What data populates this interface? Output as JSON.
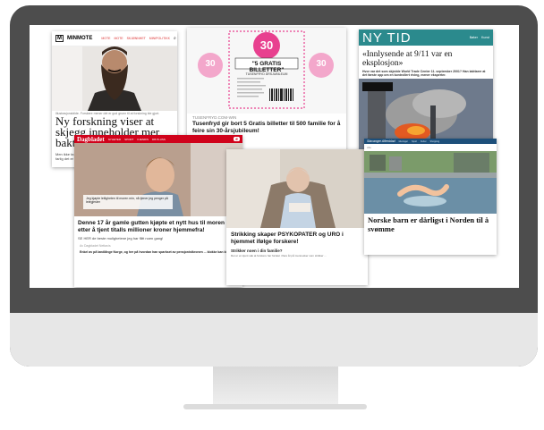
{
  "minmote": {
    "logo": "MINMOTE",
    "nav": [
      "MOTE",
      "MOTE",
      "SKJØNNHET",
      "MINIPOLITIKK"
    ],
    "caption": "Illustrasjonsbilde. Forskere mener det er god grunn til at forskning ble gjort.",
    "headline": "Ny forskning viser at skjegg inneholder mer bakterier enn toaletter",
    "headline_visible": "Ny forskning viser at skjegg inneh... toalett...",
    "side_text": "Men ikke ta farlig det er bra",
    "side_link": "Les også"
  },
  "tusenfryd": {
    "badge_number": "30",
    "banner": "\"5 GRATIS BILLETTER\"",
    "subtitle": "TUSENFRYD ÅRSJUBILEUM",
    "source": "TUSENFRYD.COM-WIN",
    "headline": "Tusenfryd gir bort 5 Gratis billetter til 500 familie for å feire sin 30-årsjubileum!"
  },
  "nytid": {
    "logo": "NY TID",
    "nav": [
      "Bøker",
      "Kunst"
    ],
    "headline": "«Innlysende at 9/11 var en eksplosjon»",
    "lead": "Hvor var det som skjedde World Trade Center 11. september 2001? Han iakttarer at det første opp om en kontrollert riving, mener eksperter."
  },
  "dagbladet": {
    "logo": "Dagbladet",
    "nav_red": [
      "NYHETER",
      "SPORT",
      "KJENDIS",
      "DB PLUSS"
    ],
    "pill": "E",
    "video_caption": "Jeg kjøpte leiligheten til moren min, nå tjener jeg penger på leiegjester",
    "headline": "Denne 17 år gamle gutten kjøpte et nytt hus til moren sin etter å tjent titalls millioner kroner hjemmefra!",
    "subtext": "SE HER de beste mulighetene jeg har fått noen gang!",
    "byline": "Av Dagbladet Nettavis",
    "body": "Enkel av på landlånge Norge, og her på hvordan han sparkset av pensjonistkronen ... klokke kan bli at ..."
  },
  "strikking": {
    "headline": "Strikking skaper PSYKOPATER og URO i hjemmet ifølge forskere!",
    "subhead": "Strikker noen i din familie?",
    "body": "Det er en kjent sak at forskere har forsket i flere år på mennesker som strikker ..."
  },
  "svomme": {
    "logo": "Stavanger Aftenblad",
    "nav": [
      "Meninger",
      "Sport",
      "Kultur",
      "Shopping"
    ],
    "section": "Alle",
    "headline": "Norske barn er dårligst i Norden til å svømme"
  },
  "colors": {
    "bezel": "#4d4d4d",
    "chin": "#e7e7e7",
    "nytid_teal": "#2b8a8d",
    "tusenfryd_pink": "#e8408f",
    "dagbladet_red": "#d0021b",
    "aftenblad_blue": "#1d4f7a"
  }
}
